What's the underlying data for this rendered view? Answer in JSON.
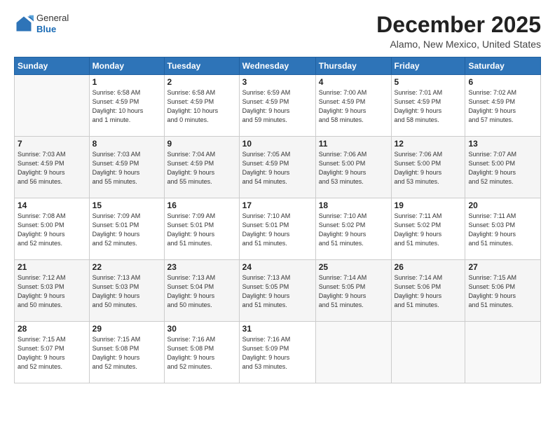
{
  "header": {
    "logo_line1": "General",
    "logo_line2": "Blue",
    "month": "December 2025",
    "location": "Alamo, New Mexico, United States"
  },
  "days_of_week": [
    "Sunday",
    "Monday",
    "Tuesday",
    "Wednesday",
    "Thursday",
    "Friday",
    "Saturday"
  ],
  "weeks": [
    [
      {
        "day": "",
        "info": ""
      },
      {
        "day": "1",
        "info": "Sunrise: 6:58 AM\nSunset: 4:59 PM\nDaylight: 10 hours\nand 1 minute."
      },
      {
        "day": "2",
        "info": "Sunrise: 6:58 AM\nSunset: 4:59 PM\nDaylight: 10 hours\nand 0 minutes."
      },
      {
        "day": "3",
        "info": "Sunrise: 6:59 AM\nSunset: 4:59 PM\nDaylight: 9 hours\nand 59 minutes."
      },
      {
        "day": "4",
        "info": "Sunrise: 7:00 AM\nSunset: 4:59 PM\nDaylight: 9 hours\nand 58 minutes."
      },
      {
        "day": "5",
        "info": "Sunrise: 7:01 AM\nSunset: 4:59 PM\nDaylight: 9 hours\nand 58 minutes."
      },
      {
        "day": "6",
        "info": "Sunrise: 7:02 AM\nSunset: 4:59 PM\nDaylight: 9 hours\nand 57 minutes."
      }
    ],
    [
      {
        "day": "7",
        "info": "Sunrise: 7:03 AM\nSunset: 4:59 PM\nDaylight: 9 hours\nand 56 minutes."
      },
      {
        "day": "8",
        "info": "Sunrise: 7:03 AM\nSunset: 4:59 PM\nDaylight: 9 hours\nand 55 minutes."
      },
      {
        "day": "9",
        "info": "Sunrise: 7:04 AM\nSunset: 4:59 PM\nDaylight: 9 hours\nand 55 minutes."
      },
      {
        "day": "10",
        "info": "Sunrise: 7:05 AM\nSunset: 4:59 PM\nDaylight: 9 hours\nand 54 minutes."
      },
      {
        "day": "11",
        "info": "Sunrise: 7:06 AM\nSunset: 5:00 PM\nDaylight: 9 hours\nand 53 minutes."
      },
      {
        "day": "12",
        "info": "Sunrise: 7:06 AM\nSunset: 5:00 PM\nDaylight: 9 hours\nand 53 minutes."
      },
      {
        "day": "13",
        "info": "Sunrise: 7:07 AM\nSunset: 5:00 PM\nDaylight: 9 hours\nand 52 minutes."
      }
    ],
    [
      {
        "day": "14",
        "info": "Sunrise: 7:08 AM\nSunset: 5:00 PM\nDaylight: 9 hours\nand 52 minutes."
      },
      {
        "day": "15",
        "info": "Sunrise: 7:09 AM\nSunset: 5:01 PM\nDaylight: 9 hours\nand 52 minutes."
      },
      {
        "day": "16",
        "info": "Sunrise: 7:09 AM\nSunset: 5:01 PM\nDaylight: 9 hours\nand 51 minutes."
      },
      {
        "day": "17",
        "info": "Sunrise: 7:10 AM\nSunset: 5:01 PM\nDaylight: 9 hours\nand 51 minutes."
      },
      {
        "day": "18",
        "info": "Sunrise: 7:10 AM\nSunset: 5:02 PM\nDaylight: 9 hours\nand 51 minutes."
      },
      {
        "day": "19",
        "info": "Sunrise: 7:11 AM\nSunset: 5:02 PM\nDaylight: 9 hours\nand 51 minutes."
      },
      {
        "day": "20",
        "info": "Sunrise: 7:11 AM\nSunset: 5:03 PM\nDaylight: 9 hours\nand 51 minutes."
      }
    ],
    [
      {
        "day": "21",
        "info": "Sunrise: 7:12 AM\nSunset: 5:03 PM\nDaylight: 9 hours\nand 50 minutes."
      },
      {
        "day": "22",
        "info": "Sunrise: 7:13 AM\nSunset: 5:03 PM\nDaylight: 9 hours\nand 50 minutes."
      },
      {
        "day": "23",
        "info": "Sunrise: 7:13 AM\nSunset: 5:04 PM\nDaylight: 9 hours\nand 50 minutes."
      },
      {
        "day": "24",
        "info": "Sunrise: 7:13 AM\nSunset: 5:05 PM\nDaylight: 9 hours\nand 51 minutes."
      },
      {
        "day": "25",
        "info": "Sunrise: 7:14 AM\nSunset: 5:05 PM\nDaylight: 9 hours\nand 51 minutes."
      },
      {
        "day": "26",
        "info": "Sunrise: 7:14 AM\nSunset: 5:06 PM\nDaylight: 9 hours\nand 51 minutes."
      },
      {
        "day": "27",
        "info": "Sunrise: 7:15 AM\nSunset: 5:06 PM\nDaylight: 9 hours\nand 51 minutes."
      }
    ],
    [
      {
        "day": "28",
        "info": "Sunrise: 7:15 AM\nSunset: 5:07 PM\nDaylight: 9 hours\nand 52 minutes."
      },
      {
        "day": "29",
        "info": "Sunrise: 7:15 AM\nSunset: 5:08 PM\nDaylight: 9 hours\nand 52 minutes."
      },
      {
        "day": "30",
        "info": "Sunrise: 7:16 AM\nSunset: 5:08 PM\nDaylight: 9 hours\nand 52 minutes."
      },
      {
        "day": "31",
        "info": "Sunrise: 7:16 AM\nSunset: 5:09 PM\nDaylight: 9 hours\nand 53 minutes."
      },
      {
        "day": "",
        "info": ""
      },
      {
        "day": "",
        "info": ""
      },
      {
        "day": "",
        "info": ""
      }
    ]
  ]
}
